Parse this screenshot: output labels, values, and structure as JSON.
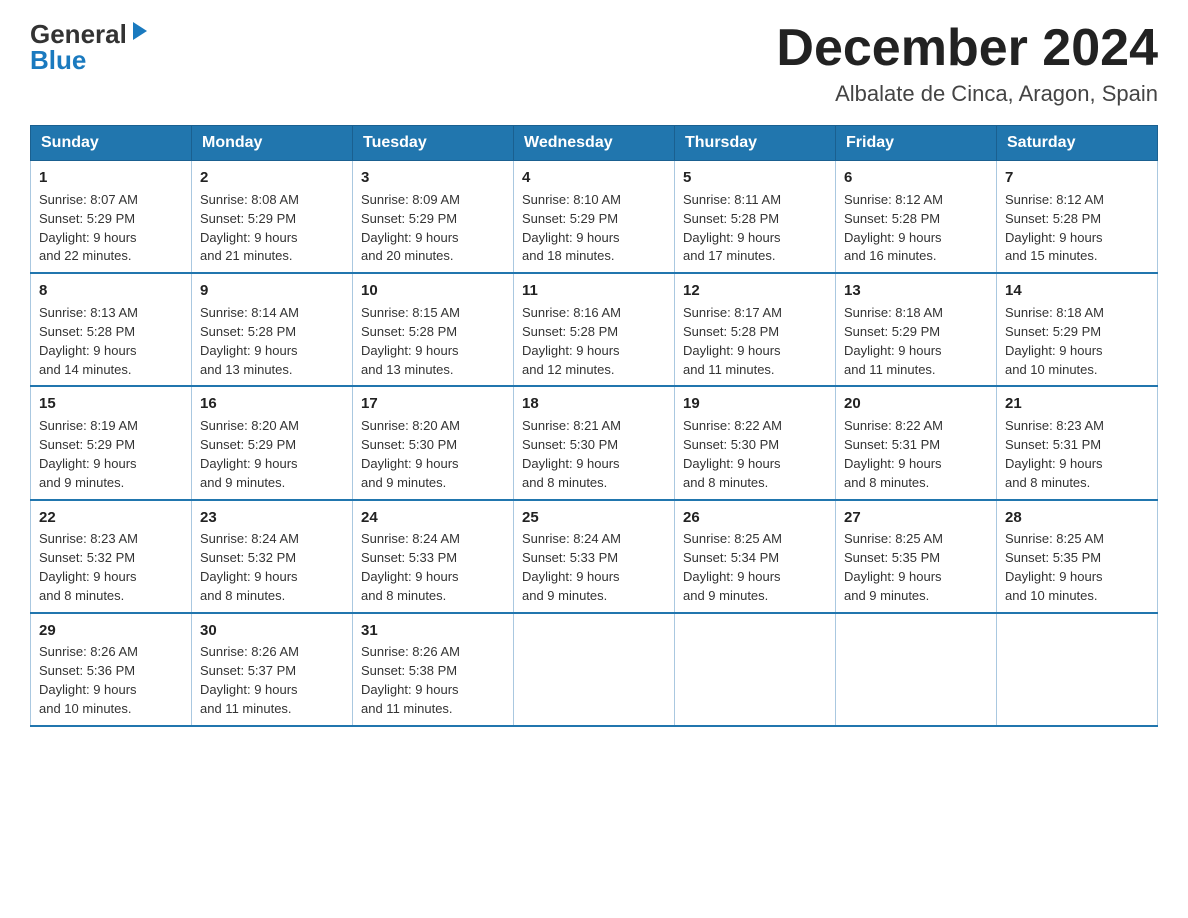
{
  "header": {
    "logo_general": "General",
    "logo_blue": "Blue",
    "month_title": "December 2024",
    "location": "Albalate de Cinca, Aragon, Spain"
  },
  "days_of_week": [
    "Sunday",
    "Monday",
    "Tuesday",
    "Wednesday",
    "Thursday",
    "Friday",
    "Saturday"
  ],
  "weeks": [
    [
      {
        "day": "1",
        "sunrise": "8:07 AM",
        "sunset": "5:29 PM",
        "daylight": "9 hours and 22 minutes."
      },
      {
        "day": "2",
        "sunrise": "8:08 AM",
        "sunset": "5:29 PM",
        "daylight": "9 hours and 21 minutes."
      },
      {
        "day": "3",
        "sunrise": "8:09 AM",
        "sunset": "5:29 PM",
        "daylight": "9 hours and 20 minutes."
      },
      {
        "day": "4",
        "sunrise": "8:10 AM",
        "sunset": "5:29 PM",
        "daylight": "9 hours and 18 minutes."
      },
      {
        "day": "5",
        "sunrise": "8:11 AM",
        "sunset": "5:28 PM",
        "daylight": "9 hours and 17 minutes."
      },
      {
        "day": "6",
        "sunrise": "8:12 AM",
        "sunset": "5:28 PM",
        "daylight": "9 hours and 16 minutes."
      },
      {
        "day": "7",
        "sunrise": "8:12 AM",
        "sunset": "5:28 PM",
        "daylight": "9 hours and 15 minutes."
      }
    ],
    [
      {
        "day": "8",
        "sunrise": "8:13 AM",
        "sunset": "5:28 PM",
        "daylight": "9 hours and 14 minutes."
      },
      {
        "day": "9",
        "sunrise": "8:14 AM",
        "sunset": "5:28 PM",
        "daylight": "9 hours and 13 minutes."
      },
      {
        "day": "10",
        "sunrise": "8:15 AM",
        "sunset": "5:28 PM",
        "daylight": "9 hours and 13 minutes."
      },
      {
        "day": "11",
        "sunrise": "8:16 AM",
        "sunset": "5:28 PM",
        "daylight": "9 hours and 12 minutes."
      },
      {
        "day": "12",
        "sunrise": "8:17 AM",
        "sunset": "5:28 PM",
        "daylight": "9 hours and 11 minutes."
      },
      {
        "day": "13",
        "sunrise": "8:18 AM",
        "sunset": "5:29 PM",
        "daylight": "9 hours and 11 minutes."
      },
      {
        "day": "14",
        "sunrise": "8:18 AM",
        "sunset": "5:29 PM",
        "daylight": "9 hours and 10 minutes."
      }
    ],
    [
      {
        "day": "15",
        "sunrise": "8:19 AM",
        "sunset": "5:29 PM",
        "daylight": "9 hours and 9 minutes."
      },
      {
        "day": "16",
        "sunrise": "8:20 AM",
        "sunset": "5:29 PM",
        "daylight": "9 hours and 9 minutes."
      },
      {
        "day": "17",
        "sunrise": "8:20 AM",
        "sunset": "5:30 PM",
        "daylight": "9 hours and 9 minutes."
      },
      {
        "day": "18",
        "sunrise": "8:21 AM",
        "sunset": "5:30 PM",
        "daylight": "9 hours and 8 minutes."
      },
      {
        "day": "19",
        "sunrise": "8:22 AM",
        "sunset": "5:30 PM",
        "daylight": "9 hours and 8 minutes."
      },
      {
        "day": "20",
        "sunrise": "8:22 AM",
        "sunset": "5:31 PM",
        "daylight": "9 hours and 8 minutes."
      },
      {
        "day": "21",
        "sunrise": "8:23 AM",
        "sunset": "5:31 PM",
        "daylight": "9 hours and 8 minutes."
      }
    ],
    [
      {
        "day": "22",
        "sunrise": "8:23 AM",
        "sunset": "5:32 PM",
        "daylight": "9 hours and 8 minutes."
      },
      {
        "day": "23",
        "sunrise": "8:24 AM",
        "sunset": "5:32 PM",
        "daylight": "9 hours and 8 minutes."
      },
      {
        "day": "24",
        "sunrise": "8:24 AM",
        "sunset": "5:33 PM",
        "daylight": "9 hours and 8 minutes."
      },
      {
        "day": "25",
        "sunrise": "8:24 AM",
        "sunset": "5:33 PM",
        "daylight": "9 hours and 9 minutes."
      },
      {
        "day": "26",
        "sunrise": "8:25 AM",
        "sunset": "5:34 PM",
        "daylight": "9 hours and 9 minutes."
      },
      {
        "day": "27",
        "sunrise": "8:25 AM",
        "sunset": "5:35 PM",
        "daylight": "9 hours and 9 minutes."
      },
      {
        "day": "28",
        "sunrise": "8:25 AM",
        "sunset": "5:35 PM",
        "daylight": "9 hours and 10 minutes."
      }
    ],
    [
      {
        "day": "29",
        "sunrise": "8:26 AM",
        "sunset": "5:36 PM",
        "daylight": "9 hours and 10 minutes."
      },
      {
        "day": "30",
        "sunrise": "8:26 AM",
        "sunset": "5:37 PM",
        "daylight": "9 hours and 11 minutes."
      },
      {
        "day": "31",
        "sunrise": "8:26 AM",
        "sunset": "5:38 PM",
        "daylight": "9 hours and 11 minutes."
      },
      null,
      null,
      null,
      null
    ]
  ],
  "labels": {
    "sunrise": "Sunrise:",
    "sunset": "Sunset:",
    "daylight": "Daylight:"
  }
}
